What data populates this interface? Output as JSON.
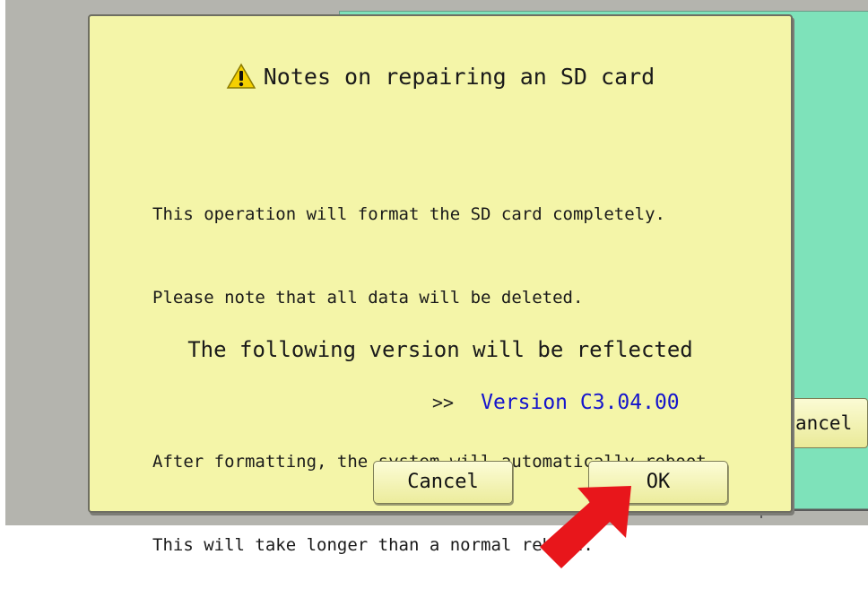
{
  "background": {
    "cancel_partial_label": "ancel"
  },
  "dialog": {
    "title": "Notes on repairing an SD card",
    "title_icon": "warning-icon",
    "paragraph1_line1": "This operation will format the SD card completely.",
    "paragraph1_line2": "Please note that all data will be deleted.",
    "paragraph2_line1": "After formatting, the system will automatically reboot.",
    "paragraph2_line2": "This will take longer than a normal reboot.",
    "reflect_text": "The following version will be reflected",
    "version_prefix": ">>",
    "version": "Version C3.04.00",
    "cancel_label": "Cancel",
    "ok_label": "OK"
  },
  "annotation": {
    "arrow_icon": "red-pointer-arrow-icon",
    "arrow_color": "#e8161b"
  },
  "colors": {
    "dialog_bg": "#f4f5a8",
    "panel_bg": "#7ee2ba",
    "version_text": "#1515cc"
  }
}
